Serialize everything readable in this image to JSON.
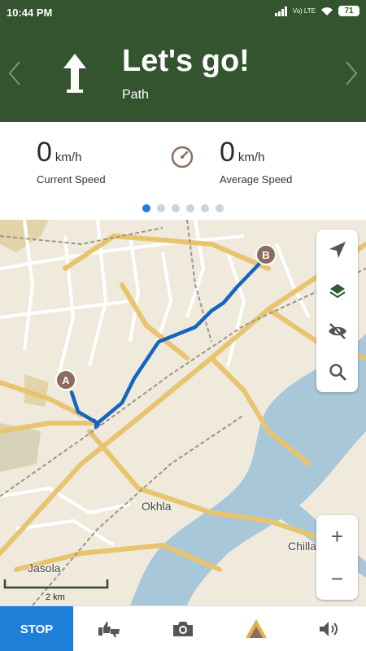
{
  "status_bar": {
    "time": "10:44 PM",
    "network": "Vo) LTE",
    "battery": "71"
  },
  "navigation": {
    "title": "Let's go!",
    "subtitle": "Path"
  },
  "stats": {
    "current_speed": {
      "value": "0",
      "unit": "km/h",
      "label": "Current Speed"
    },
    "average_speed": {
      "value": "0",
      "unit": "km/h",
      "label": "Average Speed"
    },
    "page_count": 6,
    "active_page": 1
  },
  "map": {
    "places": [
      "Okhla",
      "Jasola",
      "Chilla"
    ],
    "markers": {
      "start": "A",
      "end": "B"
    },
    "scale_label": "2 km",
    "zoom_in": "+",
    "zoom_out": "−"
  },
  "bottom_bar": {
    "stop_label": "STOP"
  },
  "colors": {
    "header": "#33542f",
    "accent": "#1e7fd8",
    "route": "#1565c0",
    "marker": "#8a6d5f"
  },
  "icons": [
    "arrow-up-icon",
    "speedometer-icon",
    "location-arrow-icon",
    "layers-icon",
    "visibility-off-icon",
    "search-icon",
    "rate-icon",
    "camera-icon",
    "navigation-icon",
    "volume-icon"
  ]
}
